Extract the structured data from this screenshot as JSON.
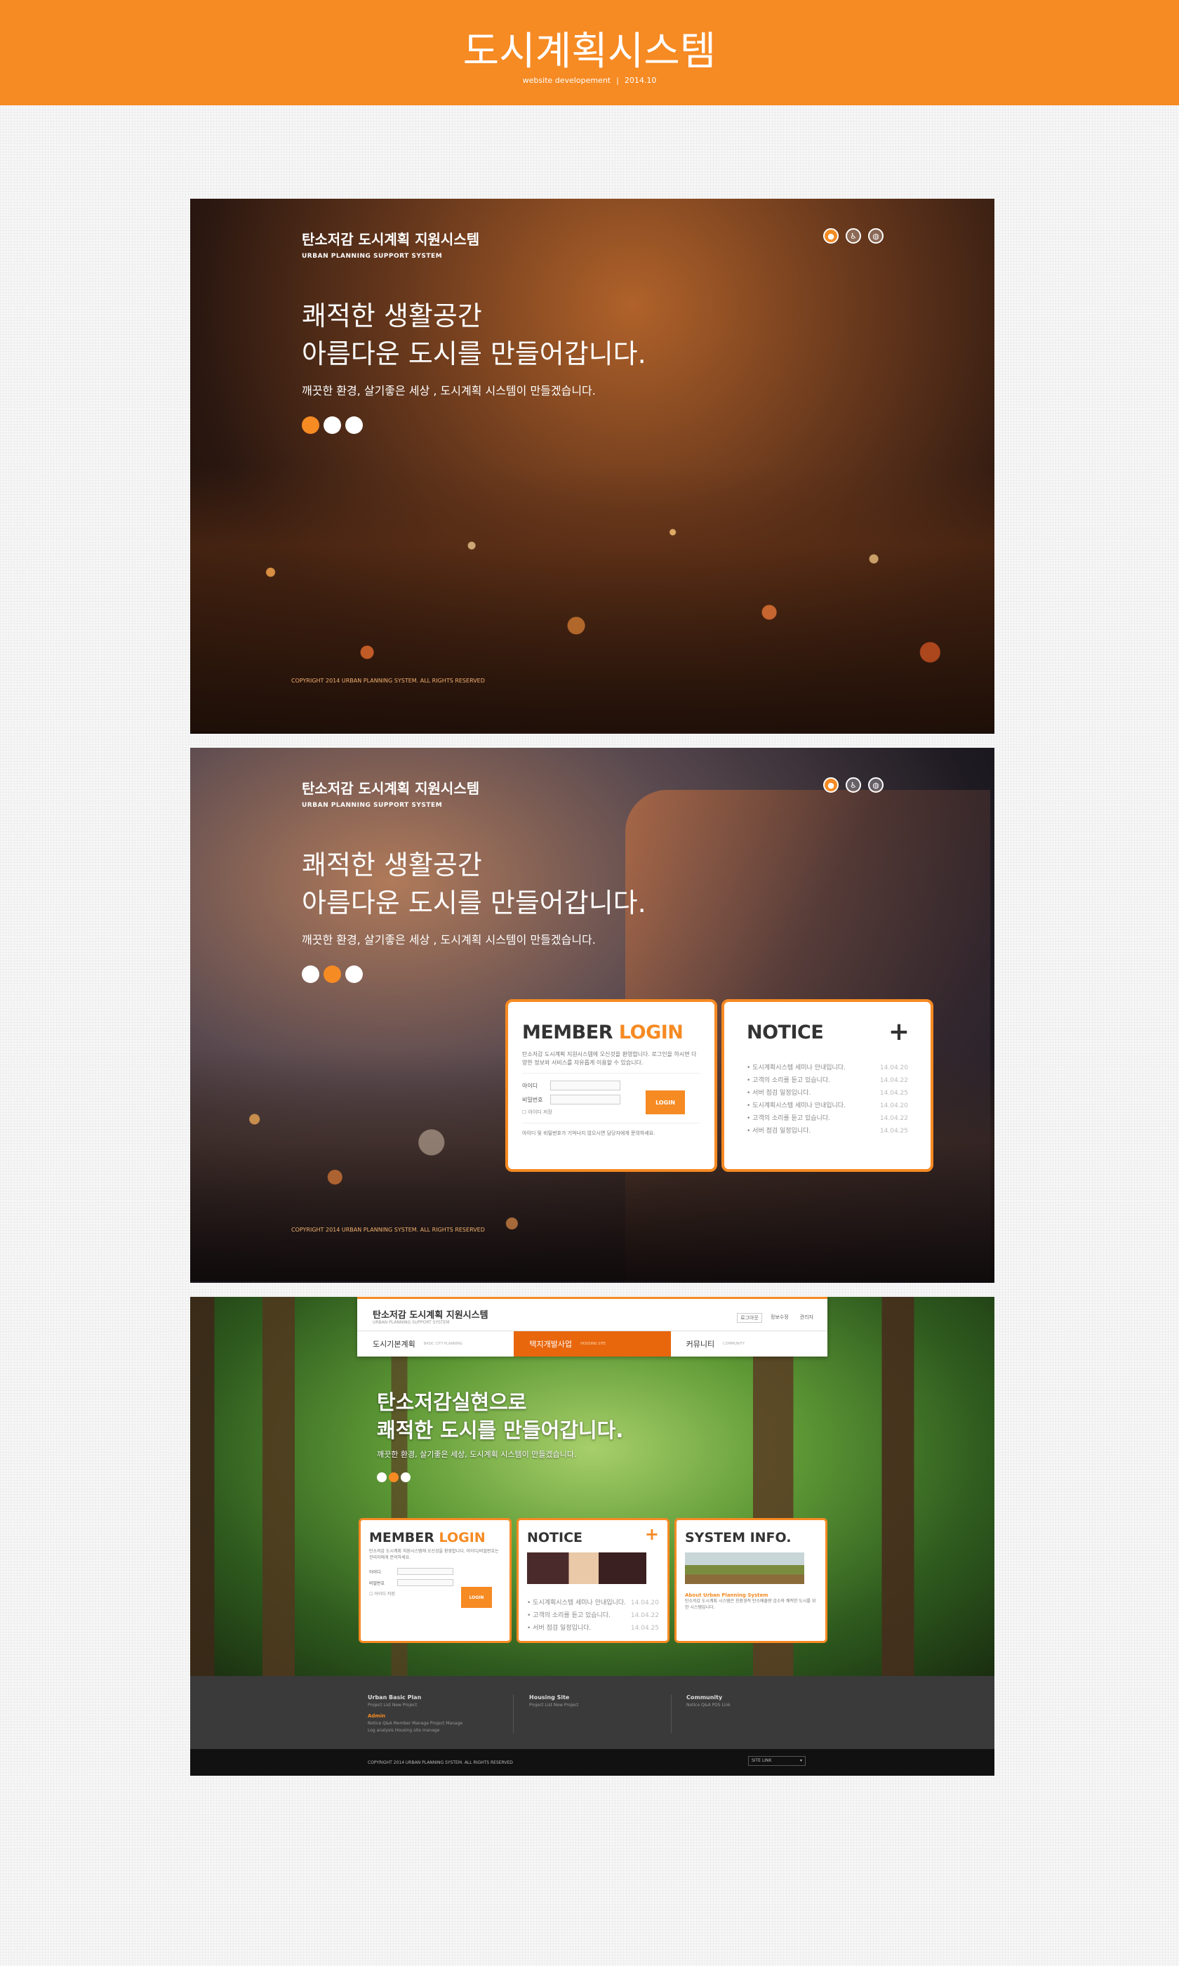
{
  "header": {
    "title": "도시계획시스템",
    "sub_left": "website developement",
    "sub_sep": "|",
    "sub_right": "2014.10"
  },
  "colors": {
    "accent": "#f68a23",
    "accent_dark": "#e8660c",
    "footer": "#3a3a3a"
  },
  "brand": {
    "ko": "탄소저감 도시계획 지원시스템",
    "en": "URBAN PLANNING SUPPORT SYSTEM"
  },
  "top_icons": [
    "person-icon",
    "accessibility-icon",
    "globe-icon"
  ],
  "hero": {
    "line1": "쾌적한 생활공간",
    "line2": "아름다운 도시를 만들어갑니다.",
    "desc": "깨끗한 환경, 살기좋은 세상 , 도시계획 시스템이 만들겠습니다."
  },
  "copyright": "COPYRIGHT 2014 URBAN PLANNING SYSTEM.  ALL RIGHTS RESERVED",
  "slider": {
    "shot1_active": 1,
    "shot2_active": 2,
    "shot3_active": 2
  },
  "login": {
    "title_a": "MEMBER",
    "title_b": "LOGIN",
    "intro": "탄소저감 도시계획 지원시스템에 오신것을 환영합니다. 로그인을 하시면 다양한 정보와 서비스를 자유롭게 이용할 수 있습니다.",
    "id_label": "아이디",
    "pw_label": "비밀번호",
    "save_label": "아이디 저장",
    "button": "LOGIN",
    "help": "아이디 및 비밀번호가 기억나지 않으시면 담당자에게 문의하세요."
  },
  "notice": {
    "title": "NOTICE",
    "plus": "+",
    "items": [
      {
        "text": "도시계획시스템 세미나 안내입니다.",
        "date": "14.04.20"
      },
      {
        "text": "고객의 소리를 듣고 있습니다.",
        "date": "14.04.22"
      },
      {
        "text": "서버 점검 일정입니다.",
        "date": "14.04.25"
      },
      {
        "text": "도시계획시스템 세미나 안내입니다.",
        "date": "14.04.20"
      },
      {
        "text": "고객의 소리를 듣고 있습니다.",
        "date": "14.04.22"
      },
      {
        "text": "서버 점검 일정입니다.",
        "date": "14.04.25"
      }
    ]
  },
  "site": {
    "ko": "탄소저감 도시계획 지원시스템",
    "en": "URBAN PLANNING SUPPORT SYSTEM",
    "util": [
      "로그아웃",
      "정보수정",
      "관리자"
    ],
    "nav": [
      {
        "ko": "도시기본계획",
        "en": "BASIC CITY PLANNING"
      },
      {
        "ko": "택지개발사업",
        "en": "HOUSING SITE"
      },
      {
        "ko": "커뮤니티",
        "en": "COMMUNITY"
      }
    ],
    "hero_l1": "탄소저감실현으로",
    "hero_l2": "쾌적한 도시를 만들어갑니다.",
    "hero_desc": "깨끗한 환경, 살기좋은 세상, 도시계획 시스템이 만들겠습니다.",
    "login_intro": "탄소저감 도시계획 지원시스템에 오신것을 환영합니다. 아이디/비밀번호는 관리자에게 문의하세요.",
    "notice_items": [
      {
        "text": "도시계획시스템 세미나 안내입니다.",
        "date": "14.04.20"
      },
      {
        "text": "고객의 소리를 듣고 있습니다.",
        "date": "14.04.22"
      },
      {
        "text": "서버 점검 일정입니다.",
        "date": "14.04.25"
      }
    ],
    "sysinfo_title": "SYSTEM INFO.",
    "sysinfo_sub": "About Urban Planning System",
    "sysinfo_text": "탄소저감 도시계획 시스템은 친환경적 탄소배출량 감소와 쾌적한 도시를 위한 시스템입니다."
  },
  "footer": {
    "col1": {
      "h": "Urban Basic Plan",
      "s": "Project List   New Project",
      "a": "Admin",
      "s2": "Notice   Q&A   Member Manage   Project Manage",
      "s3": "Log analysis   Housing site manage"
    },
    "col2": {
      "h": "Housing Site",
      "s": "Project List   New Project"
    },
    "col3": {
      "h": "Community",
      "s": "Notice   Q&A   PDS   Link"
    },
    "copyright": "COPYRIGHT 2014 URBAN PLANNING SYSTEM.  ALL RIGHTS RESERVED",
    "site_link": "SITE LINK"
  }
}
